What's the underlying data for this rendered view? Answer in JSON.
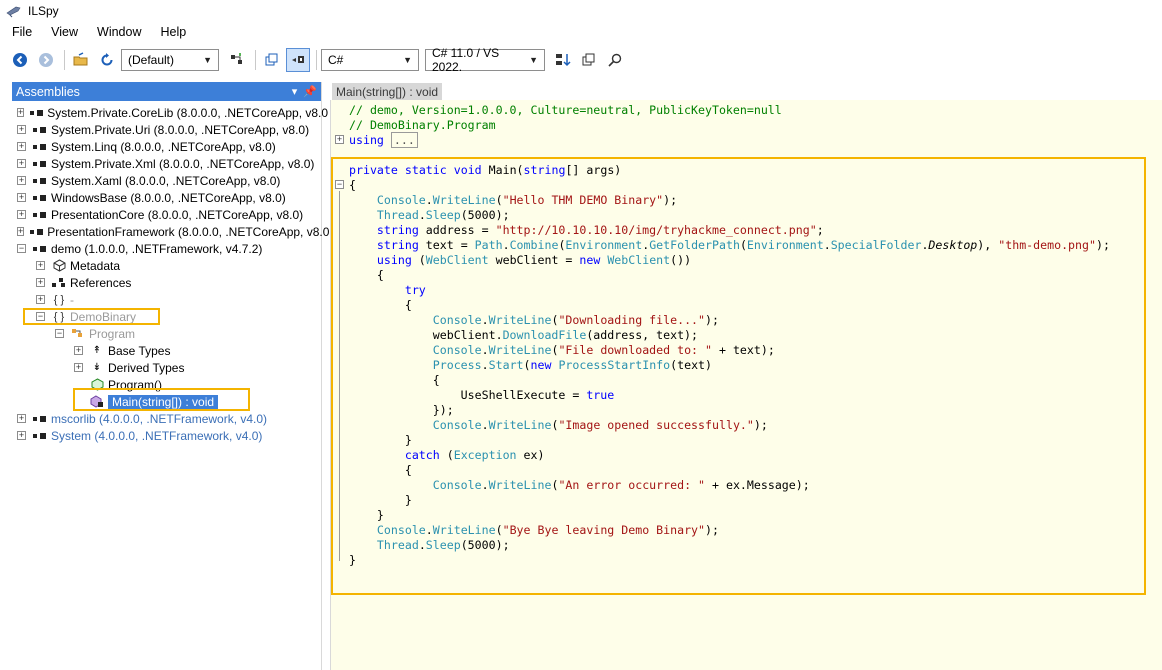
{
  "window": {
    "title": "ILSpy"
  },
  "menu": [
    "File",
    "View",
    "Window",
    "Help"
  ],
  "toolbar": {
    "filter_combo": "(Default)",
    "language_combo": "C#",
    "version_combo": "C# 11.0 / VS 2022.",
    "icons": [
      "back-icon",
      "forward-icon",
      "open-icon",
      "refresh-icon",
      "gac-icon",
      "tree-icon",
      "public-only-icon",
      "sort-icon",
      "window-icon",
      "search-icon"
    ]
  },
  "assemblies": {
    "header": "Assemblies",
    "items": [
      {
        "label": "System.Private.CoreLib (8.0.0.0, .NETCoreApp, v8.0",
        "indent": 0,
        "exp": "+",
        "style": "normal"
      },
      {
        "label": "System.Private.Uri (8.0.0.0, .NETCoreApp, v8.0)",
        "indent": 0,
        "exp": "+",
        "style": "normal"
      },
      {
        "label": "System.Linq (8.0.0.0, .NETCoreApp, v8.0)",
        "indent": 0,
        "exp": "+",
        "style": "normal"
      },
      {
        "label": "System.Private.Xml (8.0.0.0, .NETCoreApp, v8.0)",
        "indent": 0,
        "exp": "+",
        "style": "normal"
      },
      {
        "label": "System.Xaml (8.0.0.0, .NETCoreApp, v8.0)",
        "indent": 0,
        "exp": "+",
        "style": "normal"
      },
      {
        "label": "WindowsBase (8.0.0.0, .NETCoreApp, v8.0)",
        "indent": 0,
        "exp": "+",
        "style": "normal"
      },
      {
        "label": "PresentationCore (8.0.0.0, .NETCoreApp, v8.0)",
        "indent": 0,
        "exp": "+",
        "style": "normal"
      },
      {
        "label": "PresentationFramework (8.0.0.0, .NETCoreApp, v8.0",
        "indent": 0,
        "exp": "+",
        "style": "normal"
      },
      {
        "label": "demo (1.0.0.0, .NETFramework, v4.7.2)",
        "indent": 0,
        "exp": "−",
        "style": "normal"
      },
      {
        "label": "Metadata",
        "indent": 1,
        "exp": "+",
        "style": "normal"
      },
      {
        "label": "References",
        "indent": 1,
        "exp": "+",
        "style": "normal"
      },
      {
        "label": "-",
        "indent": 1,
        "exp": "+",
        "style": "gray"
      },
      {
        "label": "DemoBinary",
        "indent": 1,
        "exp": "−",
        "style": "gray"
      },
      {
        "label": "Program",
        "indent": 2,
        "exp": "−",
        "style": "gray"
      },
      {
        "label": "Base Types",
        "indent": 3,
        "exp": "+",
        "style": "normal"
      },
      {
        "label": "Derived Types",
        "indent": 3,
        "exp": "+",
        "style": "normal"
      },
      {
        "label": "Program()",
        "indent": 3,
        "exp": "",
        "style": "normal"
      },
      {
        "label": "Main(string[]) : void",
        "indent": 3,
        "exp": "",
        "style": "selected"
      },
      {
        "label": "mscorlib (4.0.0.0, .NETFramework, v4.0)",
        "indent": 0,
        "exp": "+",
        "style": "blue"
      },
      {
        "label": "System (4.0.0.0, .NETFramework, v4.0)",
        "indent": 0,
        "exp": "+",
        "style": "blue"
      }
    ]
  },
  "editor": {
    "tab": "Main(string[]) : void",
    "lines": [
      "// demo, Version=1.0.0.0, Culture=neutral, PublicKeyToken=null",
      "// DemoBinary.Program",
      "using ...",
      "",
      "private static void Main(string[] args)",
      "{",
      "Console.WriteLine(\"Hello THM DEMO Binary\");",
      "Thread.Sleep(5000);",
      "string address = \"http://10.10.10.10/img/tryhackme_connect.png\";",
      "string text = Path.Combine(Environment.GetFolderPath(Environment.SpecialFolder.Desktop), \"thm-demo.png\");",
      "using (WebClient webClient = new WebClient())",
      "{",
      "try",
      "{",
      "Console.WriteLine(\"Downloading file...\");",
      "webClient.DownloadFile(address, text);",
      "Console.WriteLine(\"File downloaded to: \" + text);",
      "Process.Start(new ProcessStartInfo(text)",
      "{",
      "UseShellExecute = true",
      "});",
      "Console.WriteLine(\"Image opened successfully.\");",
      "}",
      "catch (Exception ex)",
      "{",
      "Console.WriteLine(\"An error occurred: \" + ex.Message);",
      "}",
      "}",
      "Console.WriteLine(\"Bye Bye leaving Demo Binary\");",
      "Thread.Sleep(5000);",
      "}"
    ]
  },
  "colors": {
    "accent": "#3d7fd8",
    "highlight": "#f4b400",
    "editor_bg": "#fefee9",
    "keyword": "#0000ff",
    "type": "#2b91af",
    "string": "#a31515",
    "comment": "#008000"
  }
}
